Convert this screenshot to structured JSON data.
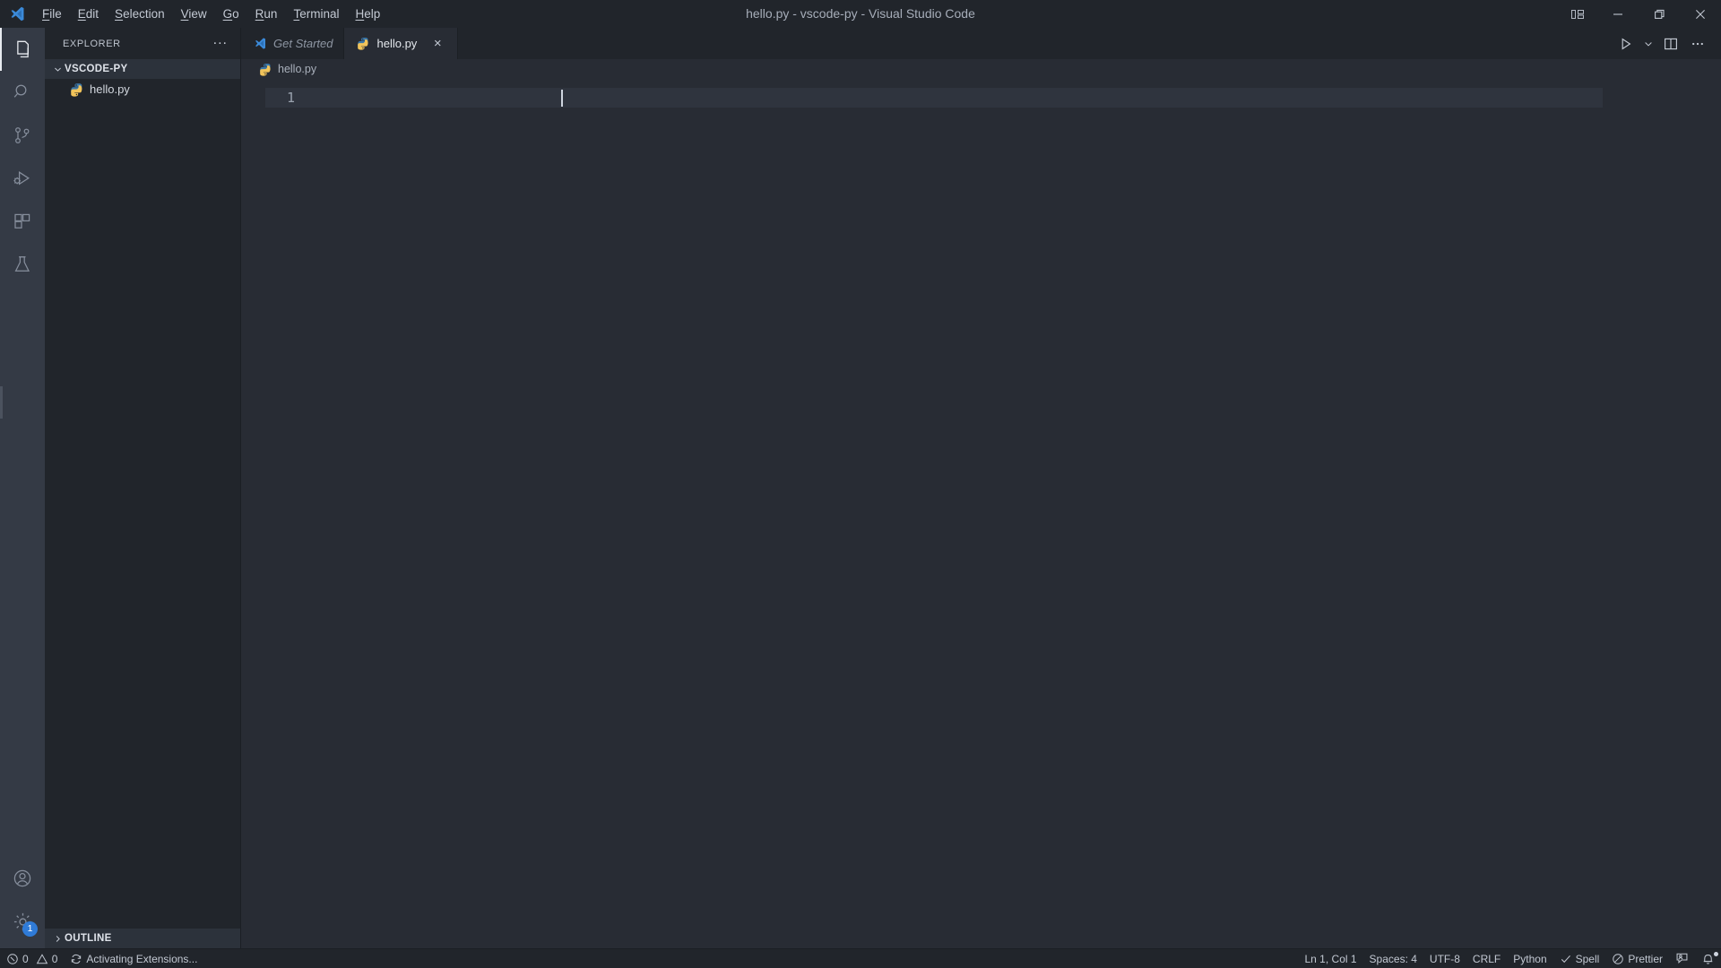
{
  "window": {
    "title": "hello.py - vscode-py - Visual Studio Code",
    "logo_icon": "vscode-logo-icon",
    "controls": {
      "layout_label": "customize-layout",
      "minimize_label": "minimize",
      "maximize_label": "maximize",
      "close_label": "close"
    }
  },
  "menubar": {
    "items": [
      {
        "label": "File",
        "mnemonic": "F"
      },
      {
        "label": "Edit",
        "mnemonic": "E"
      },
      {
        "label": "Selection",
        "mnemonic": "S"
      },
      {
        "label": "View",
        "mnemonic": "V"
      },
      {
        "label": "Go",
        "mnemonic": "G"
      },
      {
        "label": "Run",
        "mnemonic": "R"
      },
      {
        "label": "Terminal",
        "mnemonic": "T"
      },
      {
        "label": "Help",
        "mnemonic": "H"
      }
    ]
  },
  "activitybar": {
    "items": [
      {
        "name": "explorer",
        "title": "Explorer",
        "icon": "files-icon",
        "active": true
      },
      {
        "name": "search",
        "title": "Search",
        "icon": "search-icon",
        "active": false
      },
      {
        "name": "source-control",
        "title": "Source Control",
        "icon": "source-control-icon",
        "active": false
      },
      {
        "name": "run-debug",
        "title": "Run and Debug",
        "icon": "run-debug-icon",
        "active": false
      },
      {
        "name": "extensions",
        "title": "Extensions",
        "icon": "extensions-icon",
        "active": false
      },
      {
        "name": "testing",
        "title": "Testing",
        "icon": "beaker-icon",
        "active": false
      }
    ],
    "bottom": [
      {
        "name": "accounts",
        "title": "Accounts",
        "icon": "account-icon",
        "badge": ""
      },
      {
        "name": "manage",
        "title": "Manage",
        "icon": "gear-icon",
        "badge": "1"
      }
    ]
  },
  "sidebar": {
    "title": "EXPLORER",
    "more_actions": "...",
    "folder": {
      "name": "VSCODE-PY",
      "expanded": true,
      "chevron": "chevron-down"
    },
    "files": [
      {
        "name": "hello.py",
        "icon": "python-file-icon"
      }
    ],
    "outline": {
      "label": "OUTLINE",
      "expanded": false,
      "chevron": "chevron-right"
    }
  },
  "tabs": [
    {
      "label": "Get Started",
      "icon": "vscode-logo-icon",
      "active": false,
      "preview": true,
      "closable": false
    },
    {
      "label": "hello.py",
      "icon": "python-file-icon",
      "active": true,
      "preview": false,
      "closable": true,
      "close_label": "×"
    }
  ],
  "editor_actions": [
    {
      "name": "run-python-file",
      "icon": "play-icon",
      "label": "Run Python File"
    },
    {
      "name": "run-options",
      "icon": "chevron-down-icon",
      "label": ""
    },
    {
      "name": "split-editor-right",
      "icon": "split-editor-icon",
      "label": "Split Editor Right"
    },
    {
      "name": "more-actions",
      "icon": "ellipsis-icon",
      "label": "More Actions..."
    }
  ],
  "breadcrumb": {
    "icon": "python-file-icon",
    "path": "hello.py"
  },
  "editor": {
    "lines": [
      {
        "number": "1",
        "text": ""
      }
    ],
    "current_line": "1"
  },
  "statusbar": {
    "left": [
      {
        "name": "problems",
        "icon": "error-icon",
        "errors": "0",
        "warning_icon": "warning-icon",
        "warnings": "0"
      },
      {
        "name": "activating-extensions",
        "icon": "sync-spin-icon",
        "label": "Activating Extensions..."
      }
    ],
    "right": [
      {
        "name": "editor-position",
        "label": "Ln 1, Col 1"
      },
      {
        "name": "editor-indentation",
        "label": "Spaces: 4"
      },
      {
        "name": "editor-encoding",
        "label": "UTF-8"
      },
      {
        "name": "editor-eol",
        "label": "CRLF"
      },
      {
        "name": "editor-language",
        "label": "Python"
      },
      {
        "name": "spell-checker",
        "label": "Spell",
        "icon": "check-icon"
      },
      {
        "name": "prettier",
        "label": "Prettier",
        "icon": "circle-slash-icon"
      },
      {
        "name": "feedback",
        "label": "",
        "icon": "feedback-icon"
      },
      {
        "name": "notifications",
        "label": "",
        "icon": "bell-dot-icon"
      }
    ]
  },
  "colors": {
    "titlebar_bg": "#21252b",
    "activitybar_bg": "#343a45",
    "sidebar_bg": "#21252b",
    "editor_bg": "#282c34",
    "statusbar_bg": "#21252b",
    "accent_blue": "#2f7bd8",
    "text_primary": "#d2d7de",
    "text_muted": "#8e96a3",
    "python_blue": "#3b77a8",
    "python_yellow": "#f2c45a"
  }
}
